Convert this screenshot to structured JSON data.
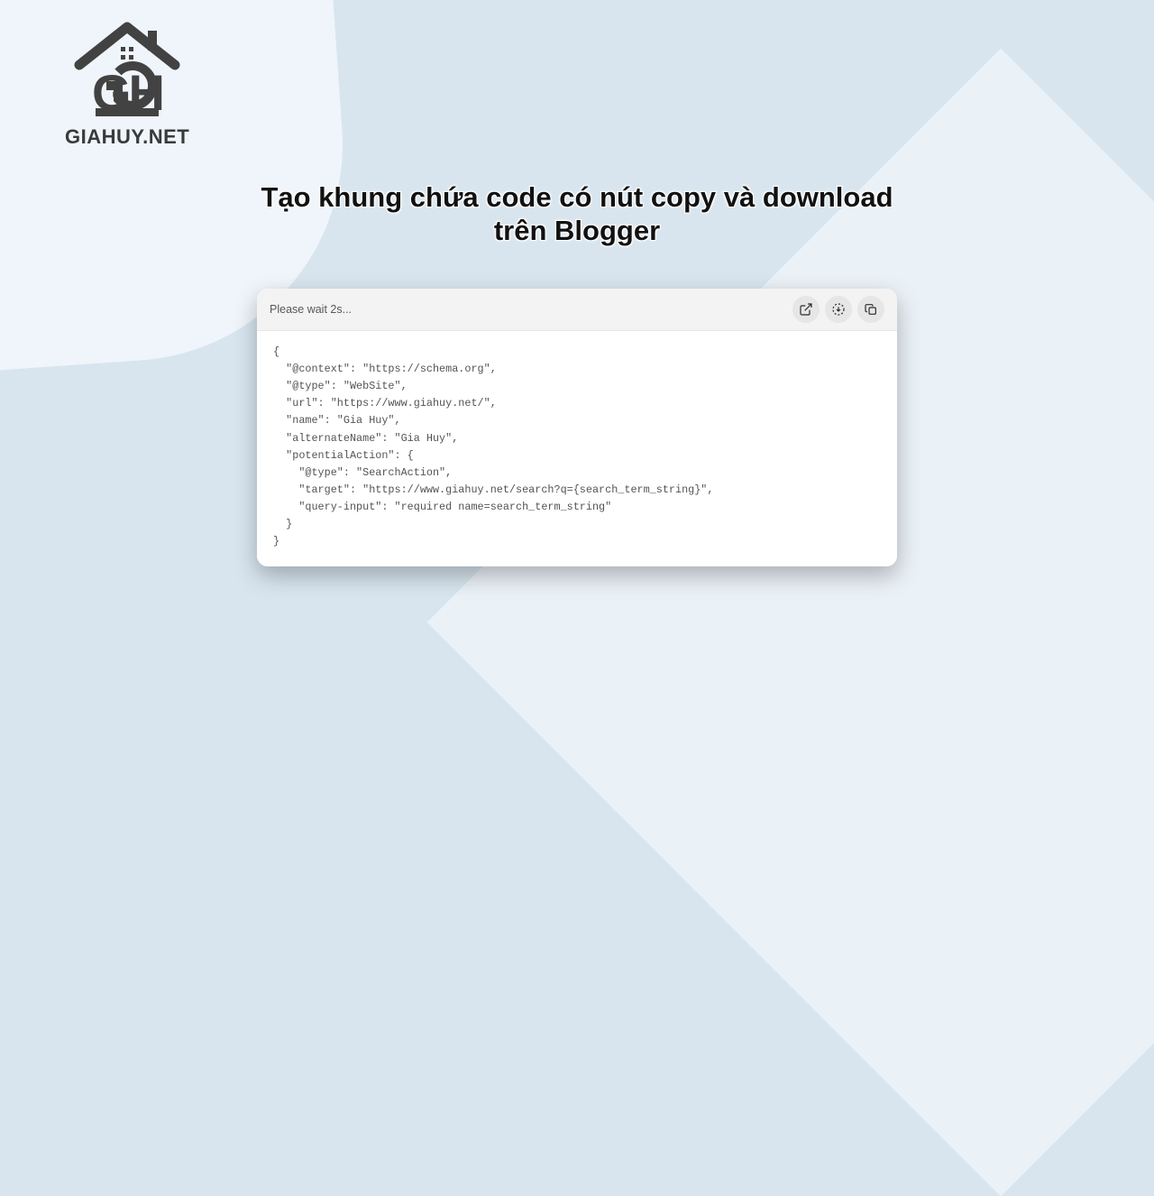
{
  "logo": {
    "text": "GIAHUY.NET"
  },
  "title": {
    "line1": "Tạo khung chứa code có nút copy và download",
    "line2": "trên Blogger"
  },
  "card": {
    "status": "Please wait 2s...",
    "code": "{\n  \"@context\": \"https://schema.org\",\n  \"@type\": \"WebSite\",\n  \"url\": \"https://www.giahuy.net/\",\n  \"name\": \"Gia Huy\",\n  \"alternateName\": \"Gia Huy\",\n  \"potentialAction\": {\n    \"@type\": \"SearchAction\",\n    \"target\": \"https://www.giahuy.net/search?q={search_term_string}\",\n    \"query-input\": \"required name=search_term_string\"\n  }\n}"
  }
}
